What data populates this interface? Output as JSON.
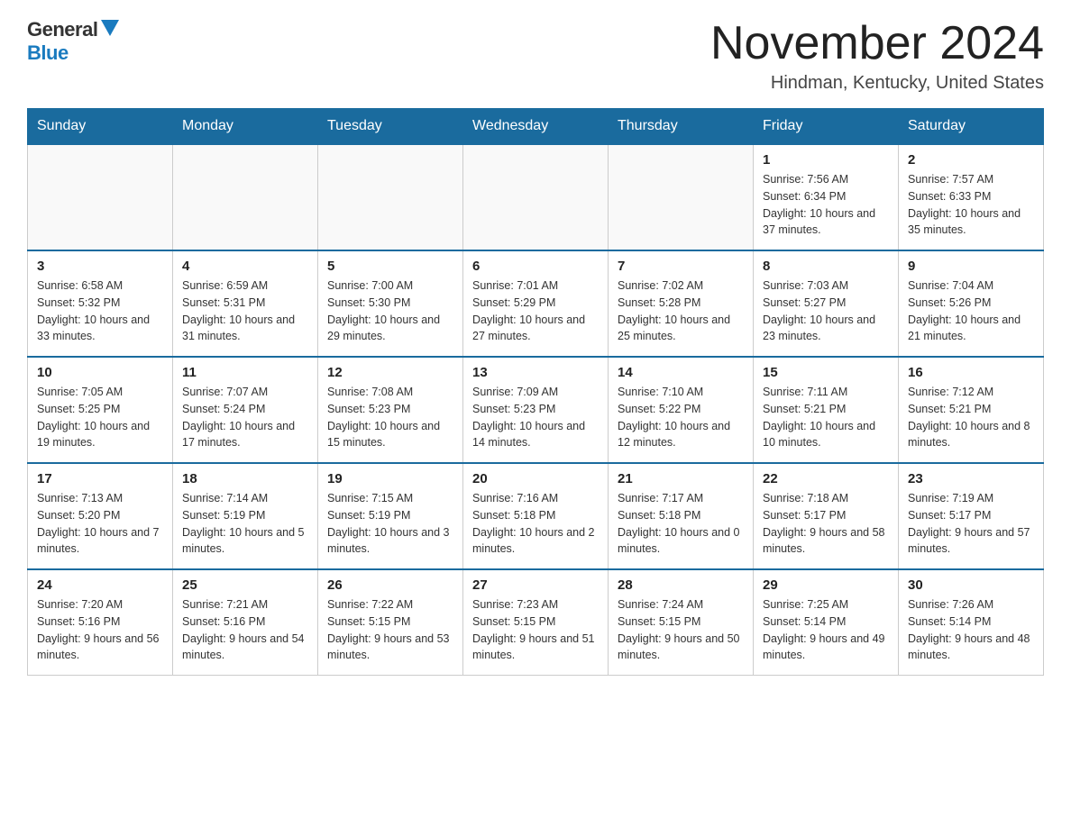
{
  "logo": {
    "general": "General",
    "blue": "Blue"
  },
  "header": {
    "month_year": "November 2024",
    "location": "Hindman, Kentucky, United States"
  },
  "weekdays": [
    "Sunday",
    "Monday",
    "Tuesday",
    "Wednesday",
    "Thursday",
    "Friday",
    "Saturday"
  ],
  "weeks": [
    [
      {
        "day": "",
        "info": ""
      },
      {
        "day": "",
        "info": ""
      },
      {
        "day": "",
        "info": ""
      },
      {
        "day": "",
        "info": ""
      },
      {
        "day": "",
        "info": ""
      },
      {
        "day": "1",
        "info": "Sunrise: 7:56 AM\nSunset: 6:34 PM\nDaylight: 10 hours and 37 minutes."
      },
      {
        "day": "2",
        "info": "Sunrise: 7:57 AM\nSunset: 6:33 PM\nDaylight: 10 hours and 35 minutes."
      }
    ],
    [
      {
        "day": "3",
        "info": "Sunrise: 6:58 AM\nSunset: 5:32 PM\nDaylight: 10 hours and 33 minutes."
      },
      {
        "day": "4",
        "info": "Sunrise: 6:59 AM\nSunset: 5:31 PM\nDaylight: 10 hours and 31 minutes."
      },
      {
        "day": "5",
        "info": "Sunrise: 7:00 AM\nSunset: 5:30 PM\nDaylight: 10 hours and 29 minutes."
      },
      {
        "day": "6",
        "info": "Sunrise: 7:01 AM\nSunset: 5:29 PM\nDaylight: 10 hours and 27 minutes."
      },
      {
        "day": "7",
        "info": "Sunrise: 7:02 AM\nSunset: 5:28 PM\nDaylight: 10 hours and 25 minutes."
      },
      {
        "day": "8",
        "info": "Sunrise: 7:03 AM\nSunset: 5:27 PM\nDaylight: 10 hours and 23 minutes."
      },
      {
        "day": "9",
        "info": "Sunrise: 7:04 AM\nSunset: 5:26 PM\nDaylight: 10 hours and 21 minutes."
      }
    ],
    [
      {
        "day": "10",
        "info": "Sunrise: 7:05 AM\nSunset: 5:25 PM\nDaylight: 10 hours and 19 minutes."
      },
      {
        "day": "11",
        "info": "Sunrise: 7:07 AM\nSunset: 5:24 PM\nDaylight: 10 hours and 17 minutes."
      },
      {
        "day": "12",
        "info": "Sunrise: 7:08 AM\nSunset: 5:23 PM\nDaylight: 10 hours and 15 minutes."
      },
      {
        "day": "13",
        "info": "Sunrise: 7:09 AM\nSunset: 5:23 PM\nDaylight: 10 hours and 14 minutes."
      },
      {
        "day": "14",
        "info": "Sunrise: 7:10 AM\nSunset: 5:22 PM\nDaylight: 10 hours and 12 minutes."
      },
      {
        "day": "15",
        "info": "Sunrise: 7:11 AM\nSunset: 5:21 PM\nDaylight: 10 hours and 10 minutes."
      },
      {
        "day": "16",
        "info": "Sunrise: 7:12 AM\nSunset: 5:21 PM\nDaylight: 10 hours and 8 minutes."
      }
    ],
    [
      {
        "day": "17",
        "info": "Sunrise: 7:13 AM\nSunset: 5:20 PM\nDaylight: 10 hours and 7 minutes."
      },
      {
        "day": "18",
        "info": "Sunrise: 7:14 AM\nSunset: 5:19 PM\nDaylight: 10 hours and 5 minutes."
      },
      {
        "day": "19",
        "info": "Sunrise: 7:15 AM\nSunset: 5:19 PM\nDaylight: 10 hours and 3 minutes."
      },
      {
        "day": "20",
        "info": "Sunrise: 7:16 AM\nSunset: 5:18 PM\nDaylight: 10 hours and 2 minutes."
      },
      {
        "day": "21",
        "info": "Sunrise: 7:17 AM\nSunset: 5:18 PM\nDaylight: 10 hours and 0 minutes."
      },
      {
        "day": "22",
        "info": "Sunrise: 7:18 AM\nSunset: 5:17 PM\nDaylight: 9 hours and 58 minutes."
      },
      {
        "day": "23",
        "info": "Sunrise: 7:19 AM\nSunset: 5:17 PM\nDaylight: 9 hours and 57 minutes."
      }
    ],
    [
      {
        "day": "24",
        "info": "Sunrise: 7:20 AM\nSunset: 5:16 PM\nDaylight: 9 hours and 56 minutes."
      },
      {
        "day": "25",
        "info": "Sunrise: 7:21 AM\nSunset: 5:16 PM\nDaylight: 9 hours and 54 minutes."
      },
      {
        "day": "26",
        "info": "Sunrise: 7:22 AM\nSunset: 5:15 PM\nDaylight: 9 hours and 53 minutes."
      },
      {
        "day": "27",
        "info": "Sunrise: 7:23 AM\nSunset: 5:15 PM\nDaylight: 9 hours and 51 minutes."
      },
      {
        "day": "28",
        "info": "Sunrise: 7:24 AM\nSunset: 5:15 PM\nDaylight: 9 hours and 50 minutes."
      },
      {
        "day": "29",
        "info": "Sunrise: 7:25 AM\nSunset: 5:14 PM\nDaylight: 9 hours and 49 minutes."
      },
      {
        "day": "30",
        "info": "Sunrise: 7:26 AM\nSunset: 5:14 PM\nDaylight: 9 hours and 48 minutes."
      }
    ]
  ]
}
